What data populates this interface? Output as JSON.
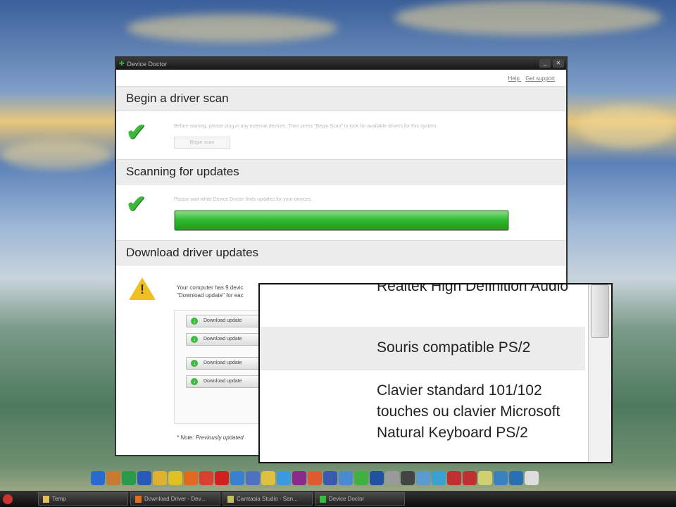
{
  "window": {
    "title": "Device Doctor",
    "links": [
      "Help",
      "Get support"
    ]
  },
  "sections": [
    {
      "title": "Begin a driver scan",
      "text": "Before starting, please plug in any external devices. Then press \"Begin Scan\" to look for available drivers for this system.",
      "button": "Begin scan"
    },
    {
      "title": "Scanning for updates",
      "text": "Please wait while Device Doctor finds updates for your devices.",
      "progress_percent": 100
    },
    {
      "title": "Download driver updates",
      "text_line1": "Your computer has 9 devic",
      "text_line2": "\"Download update\" for eac",
      "note": "* Note: Previously updated"
    }
  ],
  "download_buttons": [
    "Download update",
    "Download update",
    "Download update",
    "Download update"
  ],
  "zoom_popup": {
    "items": [
      "Realtek High Definition Audio",
      "Souris compatible PS/2",
      "Clavier standard 101/102 touches ou clavier Microsoft Natural Keyboard PS/2"
    ]
  },
  "taskbar": {
    "tasks": [
      "Temp",
      "Download Driver - Dev...",
      "Camtasia Studio - San...",
      "Device Doctor"
    ]
  },
  "dock_colors": [
    "#2a6ad0",
    "#c87a30",
    "#2a9a4a",
    "#2a5ab8",
    "#e0b030",
    "#e0c020",
    "#e06a20",
    "#d84030",
    "#d02020",
    "#3a80d0",
    "#5070c0",
    "#e0c040",
    "#3a9ae0",
    "#8a2a8a",
    "#e05a30",
    "#3a5ab0",
    "#4a8ad0",
    "#40b040",
    "#2050a0",
    "#9a9a9a",
    "#444",
    "#5a9ad0",
    "#3aa0d0",
    "#c03030",
    "#c03030",
    "#d0d070",
    "#3a80c0",
    "#2a70b0",
    "#ddd"
  ]
}
